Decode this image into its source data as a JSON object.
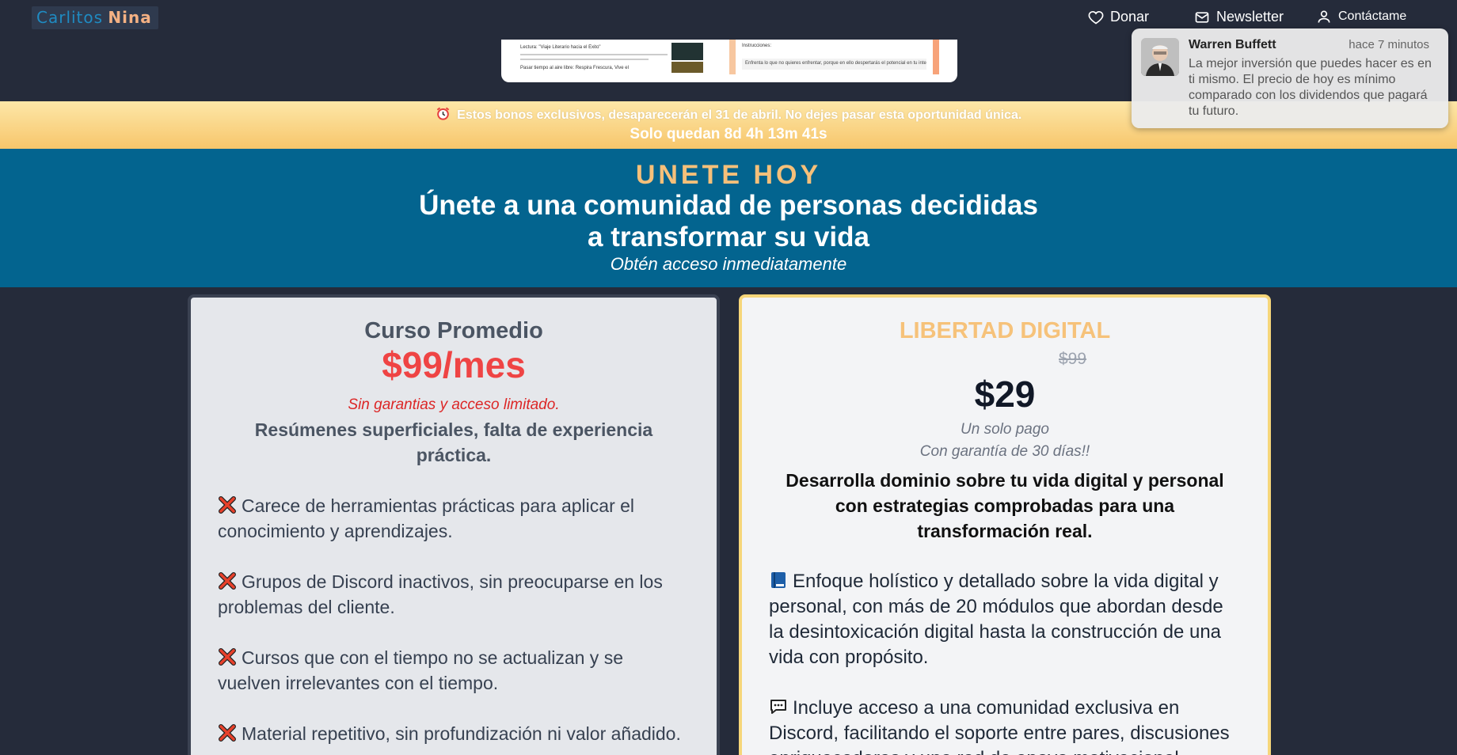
{
  "header": {
    "logo_part1": "Carlitos",
    "logo_part2": "Nina",
    "nav": {
      "donate": "Donar",
      "newsletter": "Newsletter",
      "contact": "Contáctame"
    }
  },
  "preview": {
    "left_title": "Lectura: \"Viaje Literario hacia el Éxito\"",
    "left_footer": "Pasar tiempo al aire libre: Respira Frescura, Vive el",
    "right_title": "Instrucciones:",
    "right_text": "Enfrenta lo que no quieres enfrentar, porque en ello despertarás el potencial en tu interior."
  },
  "promo": {
    "icon": "alarm-clock-icon",
    "message": "Estos bonos exclusivos, desaparecerán el 31 de abril. No dejes pasar esta oportunidad única.",
    "countdown": "Solo quedan 8d 4h 13m 41s"
  },
  "join": {
    "kicker": "UNETE HOY",
    "title": "Únete a una comunidad de personas decididas a transformar su vida",
    "subtitle": "Obtén acceso inmediatamente"
  },
  "card_basic": {
    "title": "Curso Promedio",
    "price": "$99/mes",
    "warning": "Sin garantias y acceso limitado.",
    "lead": "Resúmenes superficiales, falta de experiencia práctica.",
    "features": [
      "Carece de herramientas prácticas para aplicar el conocimiento y aprendizajes.",
      "Grupos de Discord inactivos, sin preocuparse en los problemas del cliente.",
      "Cursos que con el tiempo no se actualizan y se vuelven irrelevantes con el tiempo.",
      "Material repetitivo, sin profundización ni valor añadido."
    ]
  },
  "card_premium": {
    "title": "LIBERTAD DIGITAL",
    "old_price": "$99",
    "price": "$29",
    "note1": "Un solo pago",
    "note2": "Con garantía de 30 días!!",
    "lead": "Desarrolla dominio sobre tu vida digital y personal con estrategias comprobadas para una transformación real.",
    "features": [
      "Enfoque holístico y detallado sobre la vida digital y personal, con más de 20 módulos que abordan desde la desintoxicación digital hasta la construcción de una vida con propósito.",
      "Incluye acceso a una comunidad exclusiva en Discord, facilitando el soporte entre pares, discusiones enriquecedoras y una red de apoyo motivacional."
    ]
  },
  "notification": {
    "name": "Warren Buffett",
    "time": "hace 7 minutos",
    "message": "La mejor inversión que puedes hacer es en ti mismo. El precio de hoy es mínimo comparado con los dividendos que pagará tu futuro."
  },
  "colors": {
    "background": "#252b3a",
    "join_bg": "#03648f",
    "accent_orange": "#f6c07a",
    "price_red": "#ef4444"
  }
}
